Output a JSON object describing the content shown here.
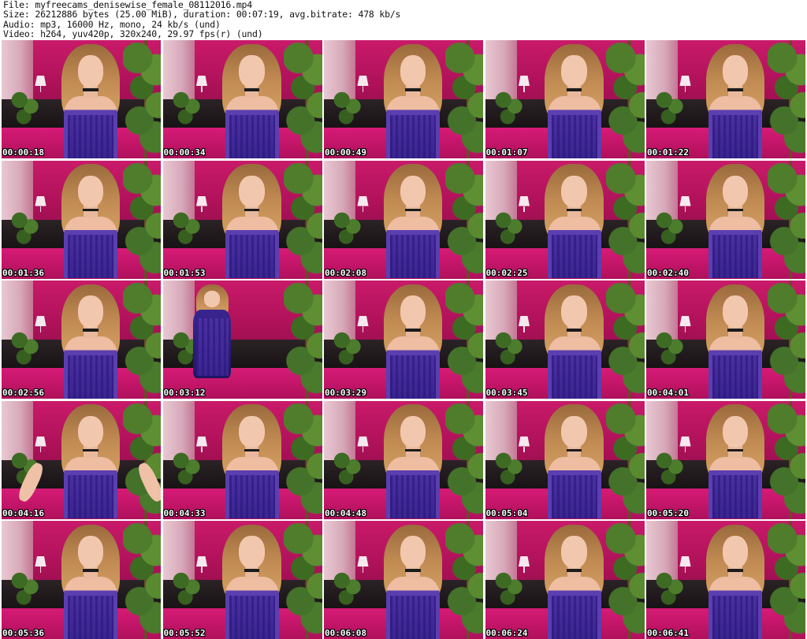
{
  "header": {
    "file_line": "File: myfreecams_denisewise_female_08112016.mp4",
    "size_line": "Size: 26212886 bytes (25.00 MiB), duration: 00:07:19, avg.bitrate: 478 kb/s",
    "audio_line": "Audio: mp3, 16000 Hz, mono, 24 kb/s (und)",
    "video_line": "Video: h264, yuv420p, 320x240, 29.97 fps(r) (und)"
  },
  "grid": {
    "columns": 5,
    "rows": 5
  },
  "thumbnails": [
    {
      "timestamp": "00:00:18",
      "variant": "seated"
    },
    {
      "timestamp": "00:00:34",
      "variant": "seated"
    },
    {
      "timestamp": "00:00:49",
      "variant": "seated"
    },
    {
      "timestamp": "00:01:07",
      "variant": "seated"
    },
    {
      "timestamp": "00:01:22",
      "variant": "seated"
    },
    {
      "timestamp": "00:01:36",
      "variant": "seated"
    },
    {
      "timestamp": "00:01:53",
      "variant": "seated"
    },
    {
      "timestamp": "00:02:08",
      "variant": "seated"
    },
    {
      "timestamp": "00:02:25",
      "variant": "seated"
    },
    {
      "timestamp": "00:02:40",
      "variant": "seated"
    },
    {
      "timestamp": "00:02:56",
      "variant": "seated"
    },
    {
      "timestamp": "00:03:12",
      "variant": "standing"
    },
    {
      "timestamp": "00:03:29",
      "variant": "seated"
    },
    {
      "timestamp": "00:03:45",
      "variant": "seated"
    },
    {
      "timestamp": "00:04:01",
      "variant": "seated"
    },
    {
      "timestamp": "00:04:16",
      "variant": "arms"
    },
    {
      "timestamp": "00:04:33",
      "variant": "seated"
    },
    {
      "timestamp": "00:04:48",
      "variant": "seated"
    },
    {
      "timestamp": "00:05:04",
      "variant": "seated"
    },
    {
      "timestamp": "00:05:20",
      "variant": "seated"
    },
    {
      "timestamp": "00:05:36",
      "variant": "seated"
    },
    {
      "timestamp": "00:05:52",
      "variant": "seated"
    },
    {
      "timestamp": "00:06:08",
      "variant": "seated"
    },
    {
      "timestamp": "00:06:24",
      "variant": "seated"
    },
    {
      "timestamp": "00:06:41",
      "variant": "seated"
    }
  ]
}
